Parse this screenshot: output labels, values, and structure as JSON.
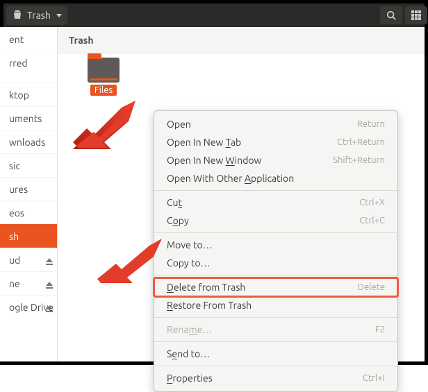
{
  "topbar": {
    "title": "Trash"
  },
  "sidebar": {
    "items": [
      {
        "label": "ent",
        "eject": false
      },
      {
        "label": "rred",
        "eject": false
      },
      {
        "label": "ktop",
        "eject": false
      },
      {
        "label": "uments",
        "eject": false
      },
      {
        "label": "wnloads",
        "eject": false
      },
      {
        "label": "sic",
        "eject": false
      },
      {
        "label": "ures",
        "eject": false
      },
      {
        "label": "eos",
        "eject": false
      },
      {
        "label": "sh",
        "eject": false,
        "selected": true
      },
      {
        "label": "ud",
        "eject": true
      },
      {
        "label": "ne",
        "eject": true
      },
      {
        "label": "ogle Drive",
        "eject": true
      }
    ]
  },
  "location": {
    "title": "Trash"
  },
  "folder": {
    "name": "Files"
  },
  "menu": {
    "open": {
      "label": "Open",
      "shortcut": "Return"
    },
    "open_tab": {
      "label_pre": "Open In New ",
      "label_u": "T",
      "label_post": "ab",
      "shortcut": "Ctrl+Return"
    },
    "open_win": {
      "label_pre": "Open In New ",
      "label_u": "W",
      "label_post": "indow",
      "shortcut": "Shift+Return"
    },
    "open_with": {
      "label_pre": "Open With Other ",
      "label_u": "A",
      "label_post": "pplication"
    },
    "cut": {
      "label_pre": "Cu",
      "label_u": "t",
      "shortcut": "Ctrl+X"
    },
    "copy": {
      "label_pre": "C",
      "label_u": "o",
      "label_post": "py",
      "shortcut": "Ctrl+C"
    },
    "move_to": {
      "label": "Move to…"
    },
    "copy_to": {
      "label": "Copy to…"
    },
    "delete": {
      "label_u": "D",
      "label_post": "elete from Trash",
      "shortcut": "Delete"
    },
    "restore": {
      "label_u": "R",
      "label_post": "estore From Trash"
    },
    "rename": {
      "label_pre": "Rena",
      "label_u": "m",
      "label_post": "e…",
      "shortcut": "F2"
    },
    "send_to": {
      "label_pre": "S",
      "label_u": "e",
      "label_post": "nd to…"
    },
    "properties": {
      "label_u": "P",
      "label_post": "roperties",
      "shortcut": "Ctrl+I"
    }
  }
}
